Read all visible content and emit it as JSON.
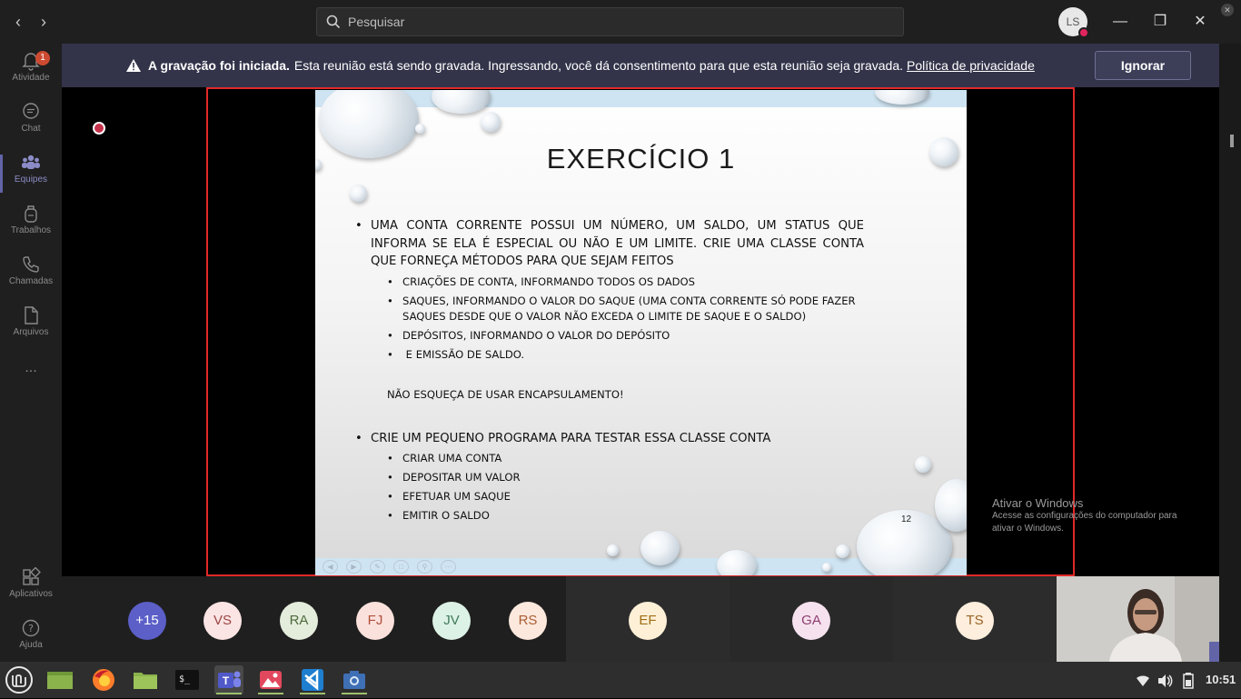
{
  "topbar": {
    "search_placeholder": "Pesquisar",
    "user_initials": "LS"
  },
  "rail": {
    "items": [
      {
        "label": "Atividade",
        "icon": "bell-icon",
        "badge": "1"
      },
      {
        "label": "Chat",
        "icon": "chat-icon"
      },
      {
        "label": "Equipes",
        "icon": "teams-icon",
        "active": true
      },
      {
        "label": "Trabalhos",
        "icon": "backpack-icon"
      },
      {
        "label": "Chamadas",
        "icon": "phone-icon"
      },
      {
        "label": "Arquivos",
        "icon": "file-icon"
      },
      {
        "label": "...",
        "icon": "more-icon"
      }
    ],
    "bottom": [
      {
        "label": "Aplicativos",
        "icon": "apps-icon"
      },
      {
        "label": "Ajuda",
        "icon": "help-icon"
      }
    ]
  },
  "banner": {
    "bold": "A gravação foi iniciada.",
    "text": "Esta reunião está sendo gravada. Ingressando, você dá consentimento para que esta reunião seja gravada.",
    "link": "Política de privacidade",
    "button": "Ignorar"
  },
  "slide": {
    "title": "EXERCÍCIO 1",
    "bullet1": "UMA CONTA CORRENTE POSSUI UM NÚMERO, UM SALDO, UM STATUS QUE INFORMA SE ELA É ESPECIAL OU NÃO E UM LIMITE. CRIE UMA CLASSE CONTA QUE FORNEÇA MÉTODOS PARA QUE SEJAM FEITOS",
    "sub1": [
      "CRIAÇÕES DE CONTA, INFORMANDO TODOS OS DADOS",
      "SAQUES, INFORMANDO O VALOR DO SAQUE (UMA CONTA CORRENTE SÓ PODE FAZER SAQUES DESDE QUE O VALOR NÃO EXCEDA O LIMITE DE SAQUE E O SALDO)",
      "DEPÓSITOS, INFORMANDO O VALOR DO DEPÓSITO",
      " E EMISSÃO DE SALDO."
    ],
    "note": "NÃO ESQUEÇA DE USAR ENCAPSULAMENTO!",
    "bullet2": "CRIE UM PEQUENO PROGRAMA PARA TESTAR ESSA CLASSE CONTA",
    "sub2": [
      "CRIAR UMA CONTA",
      "DEPOSITAR UM VALOR",
      "EFETUAR UM SAQUE",
      "EMITIR O SALDO"
    ],
    "page": "12"
  },
  "watermark": {
    "line1": "Ativar o Windows",
    "line2": "Acesse as configurações do computador para ativar o Windows."
  },
  "participants": [
    "+15",
    "VS",
    "RA",
    "FJ",
    "JV",
    "RS",
    "EF",
    "GA",
    "TS"
  ],
  "colors": {
    "accent": "#6264a7",
    "banner_bg": "#33344a",
    "frame": "#e02929",
    "record": "#c4314b"
  },
  "taskbar": {
    "time": "10:51"
  }
}
